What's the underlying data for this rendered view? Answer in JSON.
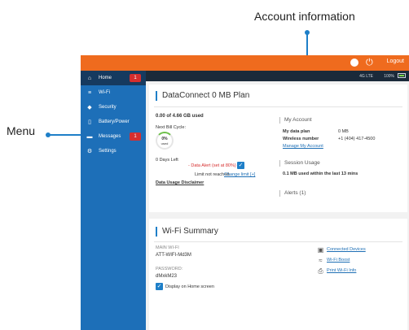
{
  "callouts": {
    "account": "Account information",
    "menu": "Menu"
  },
  "topbar": {
    "logout_label": "Logout",
    "status_signal": "4G LTE",
    "status_battery": "100%"
  },
  "sidebar": {
    "items": [
      {
        "label": "Home",
        "icon": "home-icon",
        "badge": "1",
        "active": true
      },
      {
        "label": "Wi-Fi",
        "icon": "wifi-icon",
        "badge": "",
        "active": false
      },
      {
        "label": "Security",
        "icon": "shield-icon",
        "badge": "",
        "active": false
      },
      {
        "label": "Battery/Power",
        "icon": "battery-icon",
        "badge": "",
        "active": false
      },
      {
        "label": "Messages",
        "icon": "message-icon",
        "badge": "1",
        "active": false
      },
      {
        "label": "Settings",
        "icon": "gear-icon",
        "badge": "",
        "active": false
      }
    ]
  },
  "plan": {
    "title": "DataConnect 0 MB Plan",
    "used": "0.00 of 4.66 GB used",
    "next_bill_label": "Next Bill Cycle:",
    "gauge_value": "0%",
    "gauge_sub": "used",
    "days_left": "0 Days Left",
    "alert_text": "- Data Alert (set at 80%)",
    "limit_text": "Limit not reached.",
    "change_limit": "Change limit [+]",
    "disclaimer": "Data Usage Disclaimer"
  },
  "account": {
    "section_title": "My Account",
    "data_plan_label": "My data plan",
    "data_plan_value": "0 MB",
    "wireless_label": "Wireless number",
    "wireless_value": "+1 (404) 417-4500",
    "manage_link": "Manage My Account",
    "session_title": "Session Usage",
    "session_text": "0.1 MB used within the last 13 mins",
    "alerts_title": "Alerts (1)"
  },
  "wifi": {
    "title": "Wi-Fi Summary",
    "main_label": "MAIN WI-FI",
    "main_value": "ATT-WIFI-Md3M",
    "password_label": "PASSWORD:",
    "password_value": "dMxkM23",
    "display_home": "Display on Home screen",
    "connected_devices": "Connected Devices",
    "wifi_boost": "Wi-Fi Boost",
    "print_info": "Print Wi-Fi Info"
  },
  "colors": {
    "accent_blue": "#1e7fc8",
    "topbar_orange": "#ef6b1e",
    "sidebar_blue": "#1d6fb8",
    "alert_red": "#d62e2e"
  }
}
